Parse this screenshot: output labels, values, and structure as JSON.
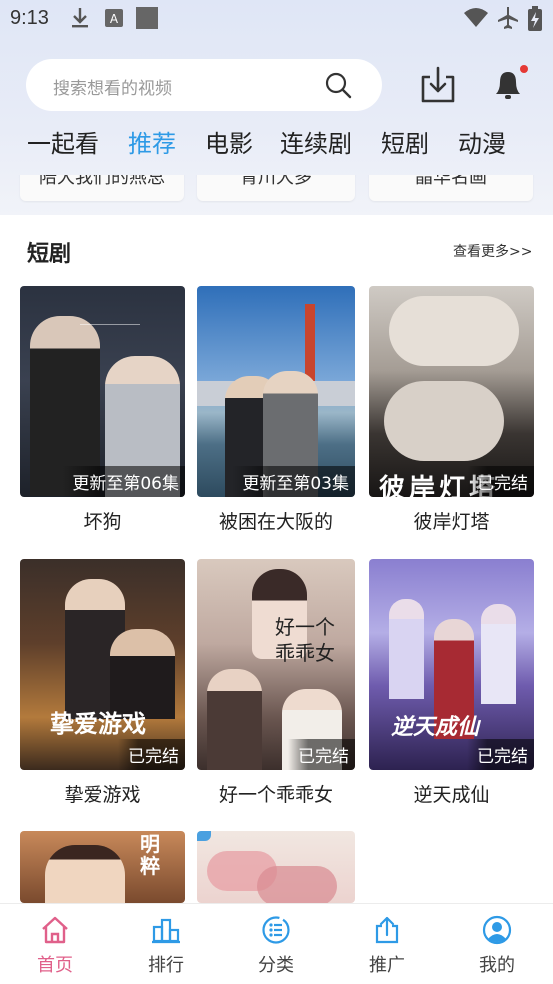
{
  "status_bar": {
    "time": "9:13"
  },
  "search": {
    "placeholder": "搜索想看的视频"
  },
  "tabs": [
    "一起看",
    "推荐",
    "电影",
    "连续剧",
    "短剧",
    "动漫"
  ],
  "previous_row_titles": [
    "陪大我们的燕总",
    "青川大多",
    "晶华名画"
  ],
  "section": {
    "title": "短剧",
    "more": "查看更多>>"
  },
  "cards": [
    {
      "title": "坏狗",
      "badge": "更新至第06集"
    },
    {
      "title": "被困在大阪的",
      "badge": "更新至第03集"
    },
    {
      "title": "彼岸灯塔",
      "badge": "已完结"
    },
    {
      "title": "挚爱游戏",
      "badge": "已完结"
    },
    {
      "title": "好一个乖乖女",
      "badge": "已完结"
    },
    {
      "title": "逆天成仙",
      "badge": "已完结"
    },
    {
      "title": "",
      "badge": ""
    },
    {
      "title": "",
      "badge": ""
    }
  ],
  "poster_text": {
    "p3_logo": "彼岸灯塔",
    "p4_logo": "挚爱游戏",
    "p5_logo": "好一个乖乖女",
    "p6_logo": "逆天成仙",
    "p7_logo": "明粹"
  },
  "bottom_nav": [
    {
      "label": "首页",
      "icon": "home-icon",
      "active": true
    },
    {
      "label": "排行",
      "icon": "ranking-icon",
      "active": false
    },
    {
      "label": "分类",
      "icon": "category-icon",
      "active": false
    },
    {
      "label": "推广",
      "icon": "share-icon",
      "active": false
    },
    {
      "label": "我的",
      "icon": "profile-icon",
      "active": false
    }
  ],
  "colors": {
    "accent": "#2e9ae6",
    "nav_active": "#e0608a",
    "notification_dot": "#e53935"
  }
}
